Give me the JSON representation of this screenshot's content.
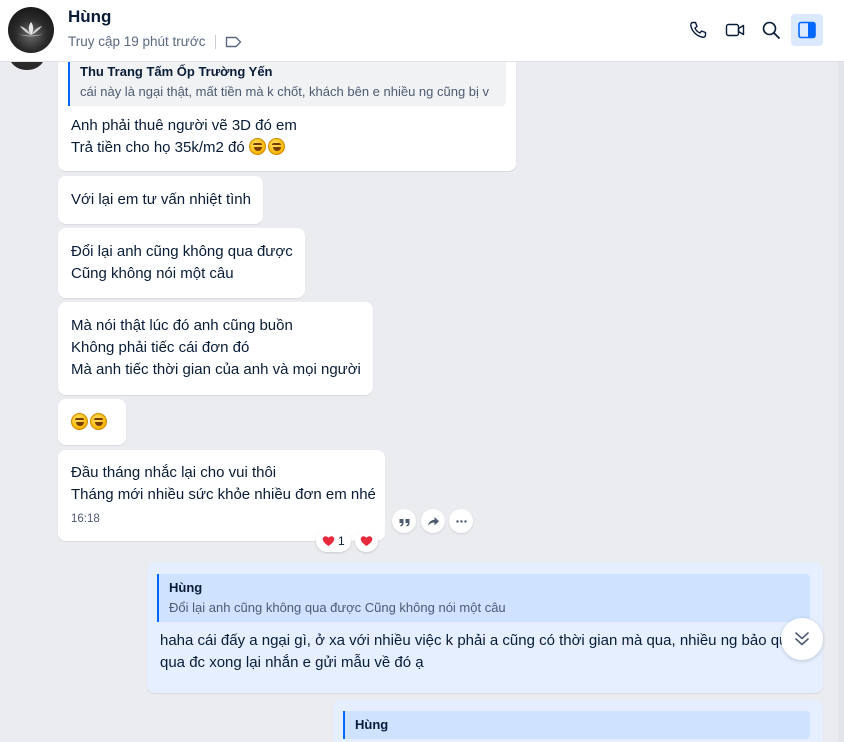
{
  "header": {
    "contact_name": "Hùng",
    "status": "Truy cập 19 phút trước",
    "icons": [
      "phone-icon",
      "video-call-icon",
      "search-icon",
      "sidebar-toggle-icon",
      "tag-icon"
    ]
  },
  "colors": {
    "accent": "#0068ff",
    "incoming_bubble": "#ffffff",
    "outgoing_bubble": "#e5efff",
    "background": "#ebecf0",
    "reaction_heart": "#e8293c"
  },
  "messages": {
    "m1": {
      "quote_name": "Thu Trang Tấm Ốp Trường Yến",
      "quote_text": "cái này là ngại thật, mất tiền mà k chốt, khách bên e nhiều ng cũng bị v",
      "line1": "Anh phải thuê người vẽ 3D đó em",
      "line2": "Trả tiền cho họ 35k/m2 đó"
    },
    "m2": {
      "line1": "Với lại em tư vấn nhiệt tình"
    },
    "m3": {
      "line1": "Đổi lại anh cũng không qua được",
      "line2": "Cũng không nói một câu"
    },
    "m4": {
      "line1": "Mà nói thật lúc đó anh cũng buồn",
      "line2": "Không phải tiếc cái đơn đó",
      "line3": "Mà anh tiếc thời gian của anh và mọi người"
    },
    "m6": {
      "line1": "Đầu tháng nhắc lại cho vui thôi",
      "line2": "Tháng mới nhiều sức khỏe nhiều đơn em nhé",
      "time": "16:18",
      "reaction_count": "1"
    },
    "m7": {
      "quote_name": "Hùng",
      "quote_text": "Đổi lại anh cũng không qua được Cũng không nói một câu",
      "line1": "haha cái đấy a ngại gì, ở xa với nhiều việc k phải a cũng có thời gian mà qua, nhiều ng bảo qua r k",
      "line2": "qua đc xong lại nhắn e gửi mẫu về đó ạ"
    },
    "m8": {
      "quote_name": "Hùng"
    }
  }
}
